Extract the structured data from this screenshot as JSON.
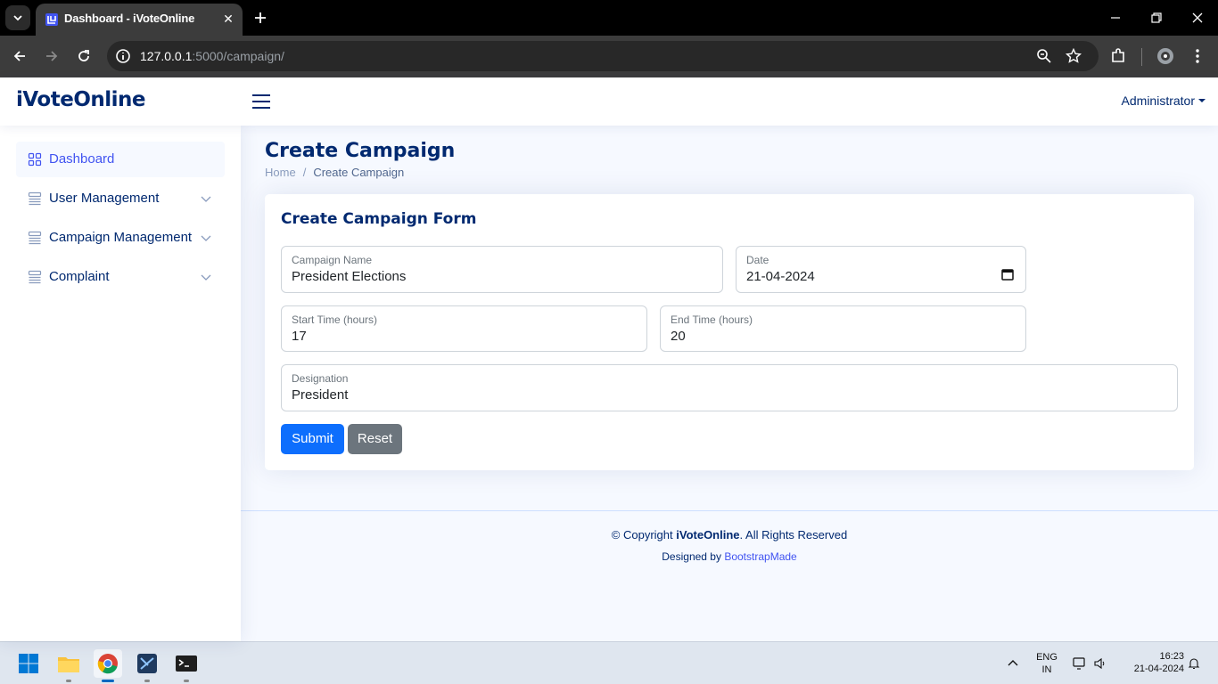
{
  "browser": {
    "tab_title": "Dashboard - iVoteOnline",
    "url_host": "127.0.0.1",
    "url_path": ":5000/campaign/"
  },
  "header": {
    "logo": "iVoteOnline",
    "user": "Administrator"
  },
  "sidebar": {
    "items": [
      {
        "label": "Dashboard",
        "icon": "grid-icon",
        "active": true
      },
      {
        "label": "User Management",
        "icon": "menu-app-icon"
      },
      {
        "label": "Campaign Management",
        "icon": "menu-app-icon"
      },
      {
        "label": "Complaint",
        "icon": "menu-app-icon"
      }
    ]
  },
  "page": {
    "title": "Create Campaign",
    "breadcrumb": [
      "Home",
      "Create Campaign"
    ]
  },
  "form": {
    "title": "Create Campaign Form",
    "campaign_name": {
      "label": "Campaign Name",
      "value": "President Elections"
    },
    "date": {
      "label": "Date",
      "value": "21-04-2024"
    },
    "start_time": {
      "label": "Start Time (hours)",
      "value": "17"
    },
    "end_time": {
      "label": "End Time (hours)",
      "value": "20"
    },
    "designation": {
      "label": "Designation",
      "value": "President"
    },
    "submit_label": "Submit",
    "reset_label": "Reset"
  },
  "footer": {
    "copyright_prefix": "© Copyright",
    "copyright_brand": "iVoteOnline",
    "copyright_suffix": ". All Rights Reserved",
    "designed_by": "Designed by",
    "designer": "BootstrapMade"
  },
  "taskbar": {
    "lang_top": "ENG",
    "lang_bottom": "IN",
    "time": "16:23",
    "date": "21-04-2024"
  },
  "colors": {
    "brand": "#012970",
    "accent": "#4154f1",
    "primary_button": "#0d6efd",
    "secondary_button": "#6c757d",
    "page_bg": "#f6f9ff"
  }
}
